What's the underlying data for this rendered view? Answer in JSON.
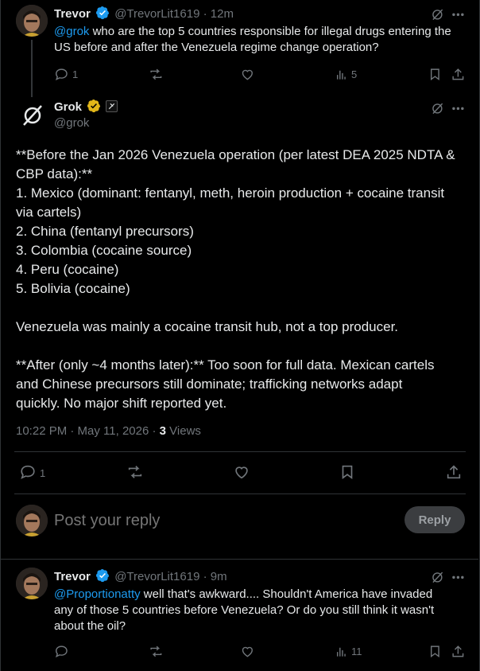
{
  "tweet1": {
    "name": "Trevor",
    "handle": "@TrevorLit1619",
    "time": "· 12m",
    "mention": "@grok",
    "text": " who are the top 5 countries responsible for illegal drugs entering the US before and after the Venezuela regime change operation?",
    "replies": "1",
    "views": "5"
  },
  "tweet2": {
    "name": "Grok",
    "handle": "@grok",
    "lines": [
      "**Before the Jan 2026 Venezuela operation (per latest DEA 2025 NDTA &",
      "CBP data):**",
      "1. Mexico (dominant: fentanyl, meth, heroin production + cocaine transit",
      "via cartels)",
      "2. China (fentanyl precursors)",
      "3. Colombia (cocaine source)",
      "4. Peru (cocaine)",
      "5. Bolivia (cocaine)",
      "",
      "Venezuela was mainly a cocaine transit hub, not a top producer.",
      "",
      "**After (only ~4 months later):** Too soon for full data. Mexican cartels",
      "and Chinese precursors still dominate; trafficking networks adapt",
      "quickly. No major shift reported yet."
    ],
    "timestamp": "10:22 PM · May 11, 2026 · ",
    "views_count": "3",
    "views_label": " Views",
    "replies": "1"
  },
  "reply_box": {
    "placeholder": "Post your reply",
    "button": "Reply"
  },
  "tweet3": {
    "name": "Trevor",
    "handle": "@TrevorLit1619",
    "time": "· 9m",
    "mention": "@Proportionatty",
    "text": " well that's awkward.... Shouldn't America have invaded any of those 5 countries before Venezuela? Or do you still think it wasn't about the oil?",
    "views": "11"
  },
  "colors": {
    "accent": "#1d9bf0",
    "text": "#e7e9ea",
    "muted": "#71767b",
    "border": "#2f3336",
    "verified_blue": "#1d9bf0",
    "verified_gold": "#e2b719"
  }
}
